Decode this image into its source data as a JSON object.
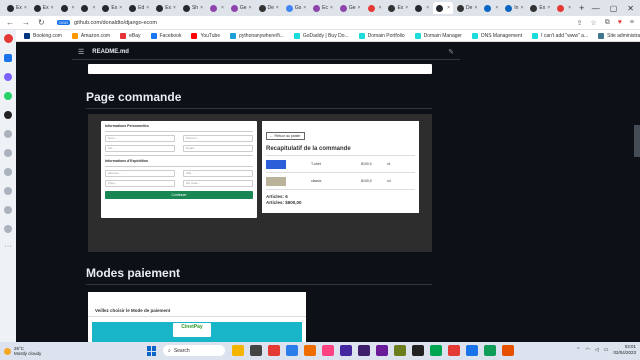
{
  "browser": {
    "tabs": [
      {
        "label": "Ex",
        "fav": "#24292f"
      },
      {
        "label": "Ex",
        "fav": "#24292f"
      },
      {
        "label": "",
        "fav": "#24292f"
      },
      {
        "label": "",
        "fav": "#24292f"
      },
      {
        "label": "Ex",
        "fav": "#24292f"
      },
      {
        "label": "Ed",
        "fav": "#24292f"
      },
      {
        "label": "Ex",
        "fav": "#24292f"
      },
      {
        "label": "Sh",
        "fav": "#24292f"
      },
      {
        "label": "",
        "fav": "#8e44ad"
      },
      {
        "label": "Ge",
        "fav": "#8e44ad"
      },
      {
        "label": "De",
        "fav": "#333"
      },
      {
        "label": "Gs",
        "fav": "#4285f4"
      },
      {
        "label": "Ec",
        "fav": "#8e44ad"
      },
      {
        "label": "Ge",
        "fav": "#8e44ad"
      },
      {
        "label": "",
        "fav": "#e53935"
      },
      {
        "label": "Ex",
        "fav": "#333"
      },
      {
        "label": "",
        "fav": "#24292f"
      },
      {
        "label": "",
        "fav": "#24292f"
      },
      {
        "label": "De",
        "fav": "#333"
      },
      {
        "label": "",
        "fav": "#0a66c2"
      },
      {
        "label": "In",
        "fav": "#0a66c2"
      },
      {
        "label": "Ex",
        "fav": "#333"
      },
      {
        "label": "",
        "fav": "#e53935"
      }
    ],
    "url": "github.com/donaldto/django-ecom",
    "url_badge": "OGG"
  },
  "bookmarks": [
    {
      "label": "Booking.com",
      "color": "#003580"
    },
    {
      "label": "Amazon.com",
      "color": "#ff9900"
    },
    {
      "label": "eBay",
      "color": "#e53238"
    },
    {
      "label": "Facebook",
      "color": "#1877f2"
    },
    {
      "label": "YouTube",
      "color": "#ff0000"
    },
    {
      "label": "pythonanywhere/fi...",
      "color": "#1d9fd7"
    },
    {
      "label": "GoDaddy | Buy Do...",
      "color": "#1bdbdb"
    },
    {
      "label": "Domain Portfolio",
      "color": "#1bdbdb"
    },
    {
      "label": "Domain Manager",
      "color": "#1bdbdb"
    },
    {
      "label": "DNS Management",
      "color": "#1bdbdb"
    },
    {
      "label": "I can't add \"www\" a...",
      "color": "#1bdbdb"
    },
    {
      "label": "Site administration...",
      "color": "#417690"
    }
  ],
  "readme": {
    "title": "README.md"
  },
  "sections": {
    "commande": "Page commande",
    "paiement": "Modes paiement"
  },
  "form": {
    "perso_label": "Informations Personnelles",
    "nom": "Nom...",
    "prenom": "Prénom...",
    "tel": "Tel...",
    "email": "Email...",
    "exp_label": "Informations d'Expédition",
    "adresse": "adresse...",
    "ville": "ville...",
    "pays": "Pays...",
    "zip": "Zip code...",
    "submit": "Continuer"
  },
  "summary": {
    "back": "← Retour au panier",
    "title": "Recapitulatif de la commande",
    "products": [
      {
        "name": "T-shirt",
        "price": "$100,0",
        "qty": "x1",
        "img_color": "#2b5fd9"
      },
      {
        "name": "classic",
        "price": "$100,0",
        "qty": "x4",
        "img_color": "#b9b39a"
      }
    ],
    "articles": "Articles: 6",
    "total": "Articles: $600,00"
  },
  "payment": {
    "title": "Veillez choisir le Mode de paiement",
    "provider": "CinetPay"
  },
  "taskbar": {
    "temp": "26°C",
    "weather": "Mostly cloudy",
    "search": "Search",
    "time": "03:01",
    "date": "02/04/2023",
    "apps": [
      "#f4b400",
      "#444",
      "#e53935",
      "#2b7de9",
      "#ef6c00",
      "#ff4081",
      "#4527a0",
      "#3d1f6b",
      "#6a1b9a",
      "#6b7d1c",
      "#222",
      "#00a651",
      "#e53935",
      "#1a73e8",
      "#0f9d58",
      "#e65100"
    ]
  }
}
